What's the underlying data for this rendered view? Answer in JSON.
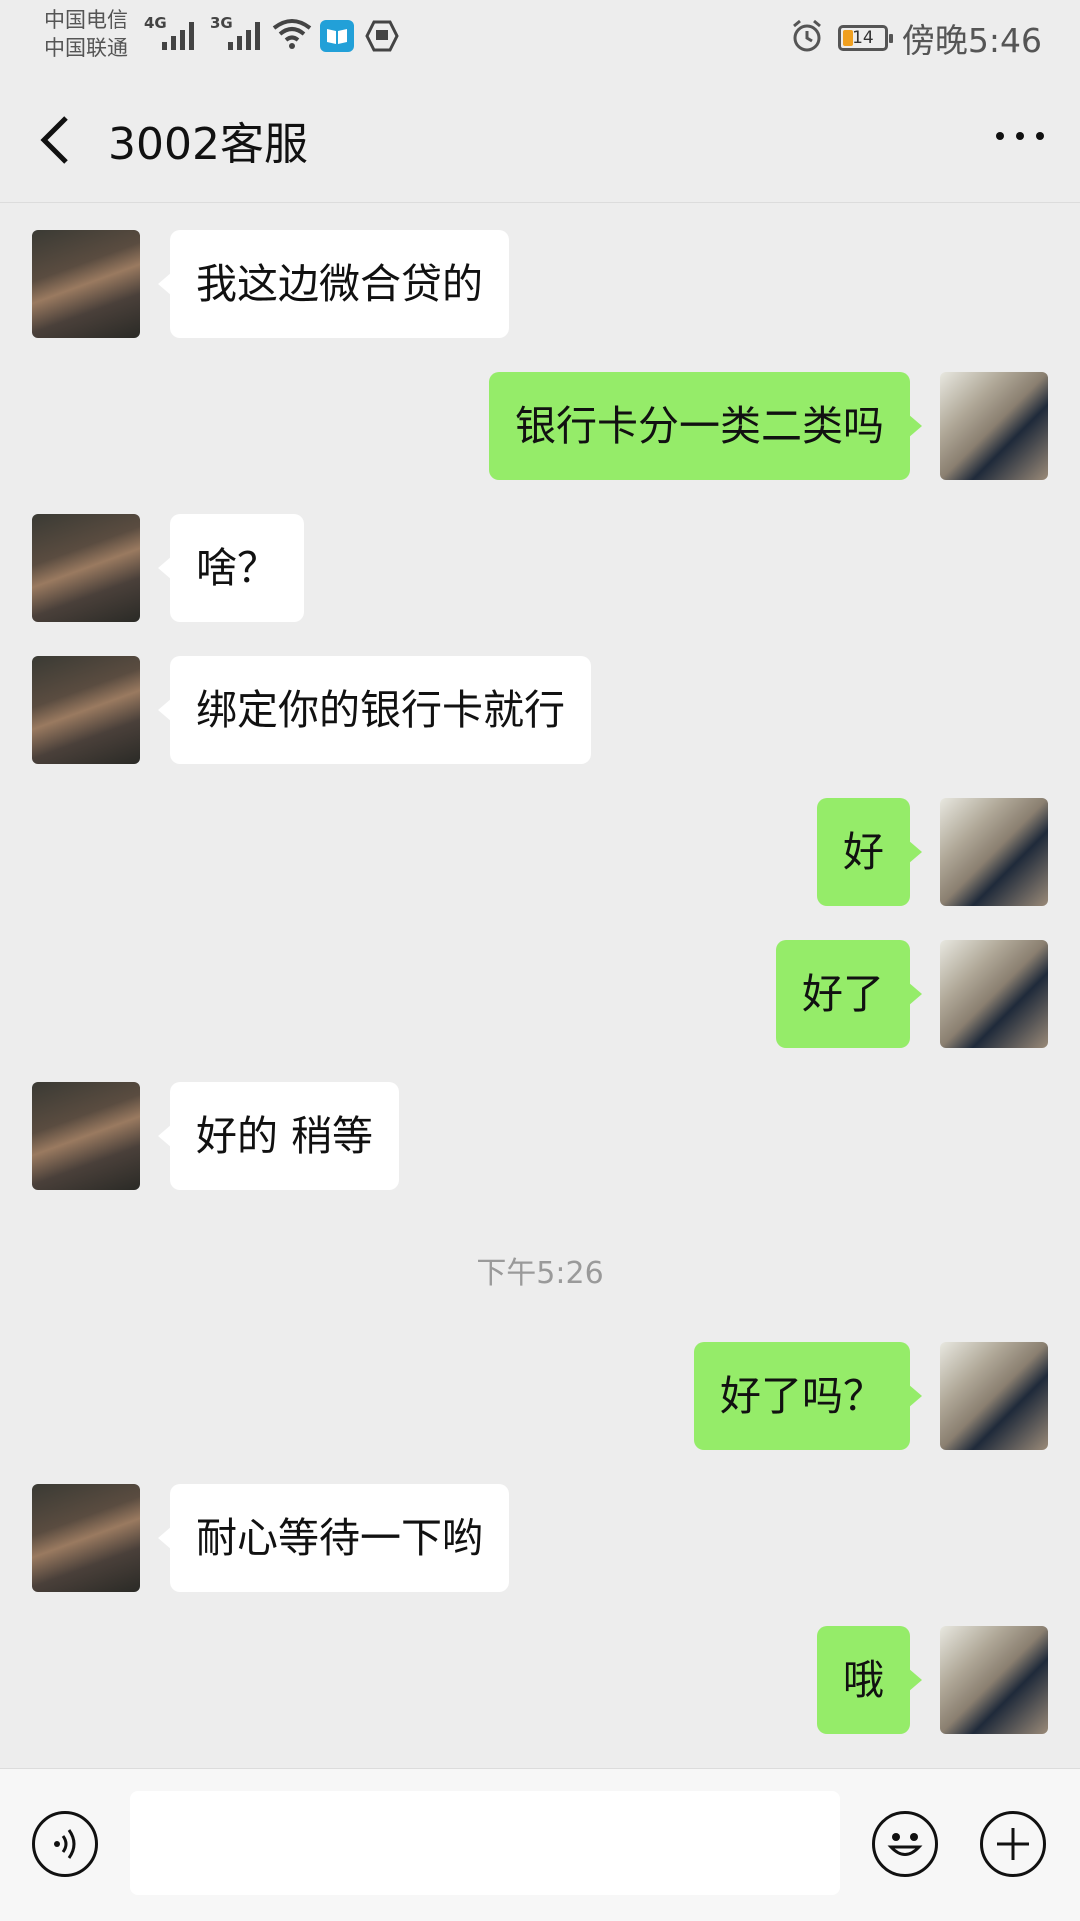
{
  "status_bar": {
    "carrier_1": "中国电信",
    "carrier_2": "中国联通",
    "net_1": "4G",
    "net_2": "3G",
    "battery": "14",
    "time": "傍晚5:46"
  },
  "header": {
    "title": "3002客服",
    "back_icon": "chevron-left-icon",
    "more_icon": "more-dots-icon"
  },
  "messages": [
    {
      "side": "left",
      "text": "我这边微合贷的"
    },
    {
      "side": "right",
      "text": "银行卡分一类二类吗"
    },
    {
      "side": "left",
      "text": "啥？"
    },
    {
      "side": "left",
      "text": "绑定你的银行卡就行"
    },
    {
      "side": "right",
      "text": "好"
    },
    {
      "side": "right",
      "text": "好了"
    },
    {
      "side": "left",
      "text": "好的 稍等"
    },
    {
      "side": "right",
      "text": "好了吗？"
    },
    {
      "side": "left",
      "text": "耐心等待一下哟"
    },
    {
      "side": "right",
      "text": "哦"
    }
  ],
  "timestamp": "下午5:26",
  "input_bar": {
    "voice_icon": "voice-icon",
    "emoji_icon": "emoji-icon",
    "plus_icon": "plus-icon",
    "input_value": ""
  },
  "colors": {
    "background": "#ededed",
    "bubble_sent": "#95ec69",
    "bubble_received": "#ffffff"
  }
}
